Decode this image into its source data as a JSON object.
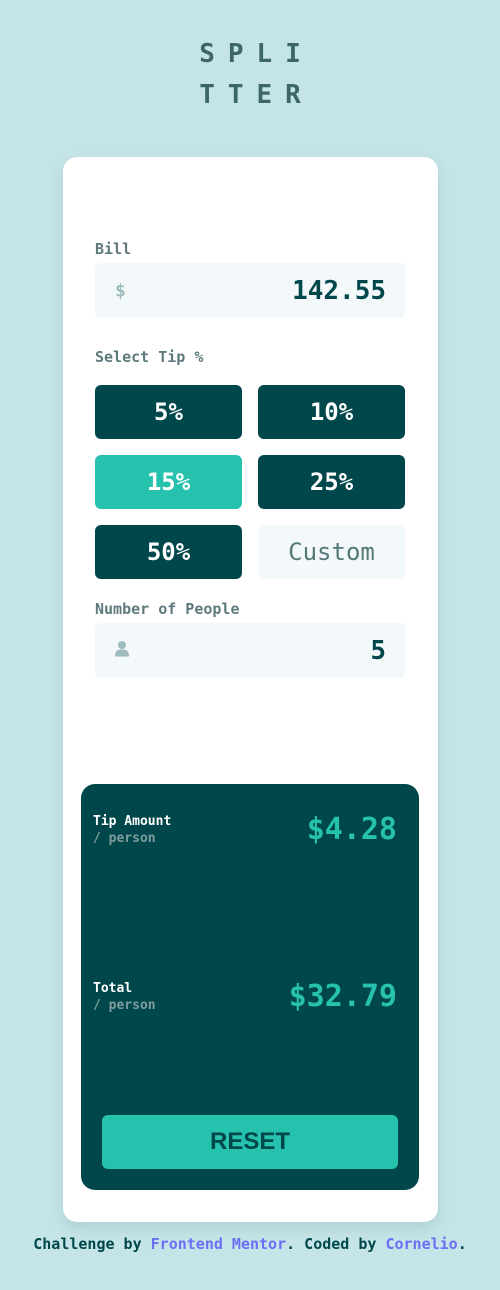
{
  "logo": {
    "line1": "SPLI",
    "line2": "TTER"
  },
  "bill": {
    "label": "Bill",
    "currency_symbol": "$",
    "value": "142.55"
  },
  "tip": {
    "label": "Select Tip %",
    "options": [
      "5%",
      "10%",
      "15%",
      "25%",
      "50%"
    ],
    "active": "15%",
    "custom_label": "Custom"
  },
  "people": {
    "label": "Number of People",
    "value": "5",
    "icon": "person-icon"
  },
  "results": {
    "tip_amount_label": "Tip Amount",
    "tip_amount_sub": "/ person",
    "tip_amount_value": "$4.28",
    "total_label": "Total",
    "total_sub": "/ person",
    "total_value": "$32.79",
    "reset_label": "RESET"
  },
  "footer": {
    "prefix": "Challenge by ",
    "link1": "Frontend Mentor",
    "middle": ". Coded by ",
    "link2": "Cornelio",
    "suffix": "."
  },
  "colors": {
    "background": "#c5e4e7",
    "dark_cyan": "#00474b",
    "accent": "#26c2ad",
    "link": "#6a6ff5"
  }
}
